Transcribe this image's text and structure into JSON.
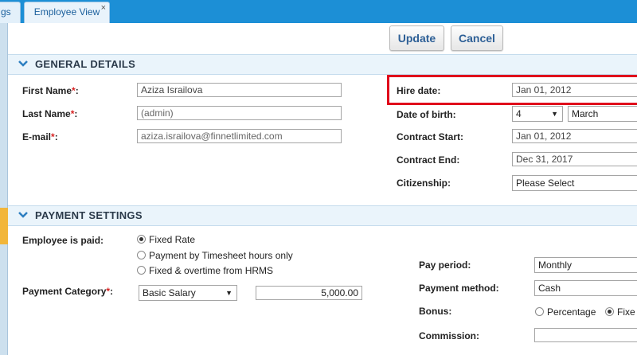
{
  "tabs": [
    {
      "label": "gs"
    },
    {
      "label": "Employee View",
      "close": "×"
    }
  ],
  "toolbar": {
    "update_label": "Update",
    "cancel_label": "Cancel"
  },
  "general": {
    "title": "GENERAL DETAILS",
    "first_name": {
      "label": "First Name",
      "value": "Aziza Israilova"
    },
    "last_name": {
      "label": "Last Name",
      "value": "(admin)"
    },
    "email": {
      "label": "E-mail",
      "value": "aziza.israilova@finnetlimited.com"
    },
    "hire_date": {
      "label": "Hire date:",
      "value": "Jan 01, 2012"
    },
    "dob": {
      "label": "Date of birth:",
      "day": "4",
      "month": "March"
    },
    "contract_start": {
      "label": "Contract Start:",
      "value": "Jan 01, 2012"
    },
    "contract_end": {
      "label": "Contract End:",
      "value": "Dec 31, 2017"
    },
    "citizenship": {
      "label": "Citizenship:",
      "value": "Please Select"
    }
  },
  "payment": {
    "title": "PAYMENT SETTINGS",
    "paid_label": "Employee is paid:",
    "paid_options": [
      {
        "label": "Fixed Rate",
        "selected": true
      },
      {
        "label": "Payment by Timesheet hours only",
        "selected": false
      },
      {
        "label": "Fixed & overtime from HRMS",
        "selected": false
      }
    ],
    "category_label": "Payment Category",
    "category_value": "Basic Salary",
    "amount": "5,000.00",
    "pay_period": {
      "label": "Pay period:",
      "value": "Monthly"
    },
    "pay_method": {
      "label": "Payment method:",
      "value": "Cash"
    },
    "bonus": {
      "label": "Bonus:",
      "opt1": "Percentage",
      "opt2": "Fixe"
    },
    "commission": {
      "label": "Commission:",
      "value": ""
    }
  },
  "colors": {
    "tabbar": "#1c8fd6",
    "highlight": "#e0001b",
    "required": "#d62222",
    "button_text": "#2d5f96"
  }
}
